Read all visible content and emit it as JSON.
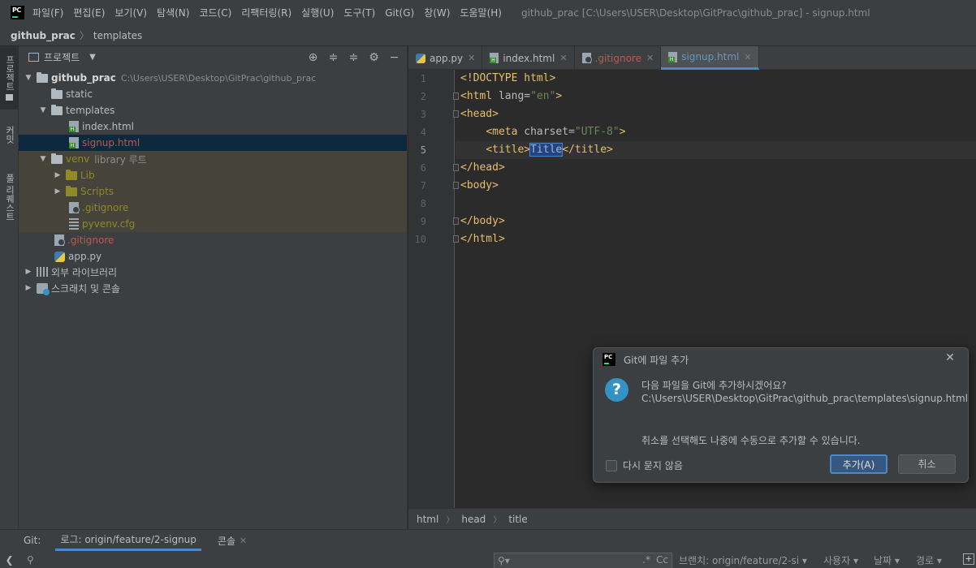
{
  "app": {
    "logo": "PC",
    "menu": [
      "파일(F)",
      "편집(E)",
      "보기(V)",
      "탐색(N)",
      "코드(C)",
      "리팩터링(R)",
      "실행(U)",
      "도구(T)",
      "Git(G)",
      "창(W)",
      "도움말(H)"
    ],
    "window_title": "github_prac [C:\\Users\\USER\\Desktop\\GitPrac\\github_prac] - signup.html"
  },
  "breadcrumb": {
    "root": "github_prac",
    "child": "templates"
  },
  "left_strip": {
    "project_tab": "프로젝트",
    "commit_tab": "커밋",
    "pr_tab": "풀 리퀘스트"
  },
  "project_panel": {
    "title": "프로젝트",
    "tree": {
      "root": {
        "name": "github_prac",
        "path": "C:\\Users\\USER\\Desktop\\GitPrac\\github_prac"
      },
      "static": "static",
      "templates": "templates",
      "index": "index.html",
      "signup": "signup.html",
      "venv": "venv",
      "venv_tag": "library 루트",
      "lib": "Lib",
      "scripts": "Scripts",
      "venv_gitignore": ".gitignore",
      "pyvenv": "pyvenv.cfg",
      "gitignore": ".gitignore",
      "app": "app.py",
      "external": "외부 라이브러리",
      "scratches": "스크래치 및 콘솔"
    }
  },
  "editor": {
    "tabs": [
      {
        "label": "app.py"
      },
      {
        "label": "index.html"
      },
      {
        "label": ".gitignore"
      },
      {
        "label": "signup.html"
      }
    ],
    "line_numbers": [
      "1",
      "2",
      "3",
      "4",
      "5",
      "6",
      "7",
      "8",
      "9",
      "10"
    ],
    "code": {
      "l1": "<!DOCTYPE html>",
      "l2_open": "<html ",
      "l2_attr": "lang=",
      "l2_val": "\"en\"",
      "l2_close": ">",
      "l3": "<head>",
      "l4_open": "<meta ",
      "l4_attr": "charset=",
      "l4_val": "\"UTF-8\"",
      "l4_close": ">",
      "l5_open": "<title>",
      "l5_text": "Title",
      "l5_close": "</title>",
      "l6": "</head>",
      "l7": "<body>",
      "l9": "</body>",
      "l10": "</html>"
    },
    "breadcrumb": [
      "html",
      "head",
      "title"
    ]
  },
  "git_panel": {
    "label": "Git:",
    "tabs": [
      {
        "label": "로그: origin/feature/2-signup"
      },
      {
        "label": "콘솔"
      }
    ],
    "filters": {
      "branch": "브랜치: origin/feature/2-si",
      "user": "사용자",
      "date": "날짜",
      "path": "경로"
    },
    "case_label": "Cc",
    "regex_label": ".*"
  },
  "dialog": {
    "title": "Git에 파일 추가",
    "question": "다음 파일을 Git에 추가하시겠어요?",
    "path": "C:\\Users\\USER\\Desktop\\GitPrac\\github_prac\\templates\\signup.html",
    "note": "취소를 선택해도 나중에 수동으로 추가할 수 있습니다.",
    "checkbox_label": "다시 묻지 않음",
    "add_label": "추가(A)",
    "cancel_label": "취소"
  }
}
